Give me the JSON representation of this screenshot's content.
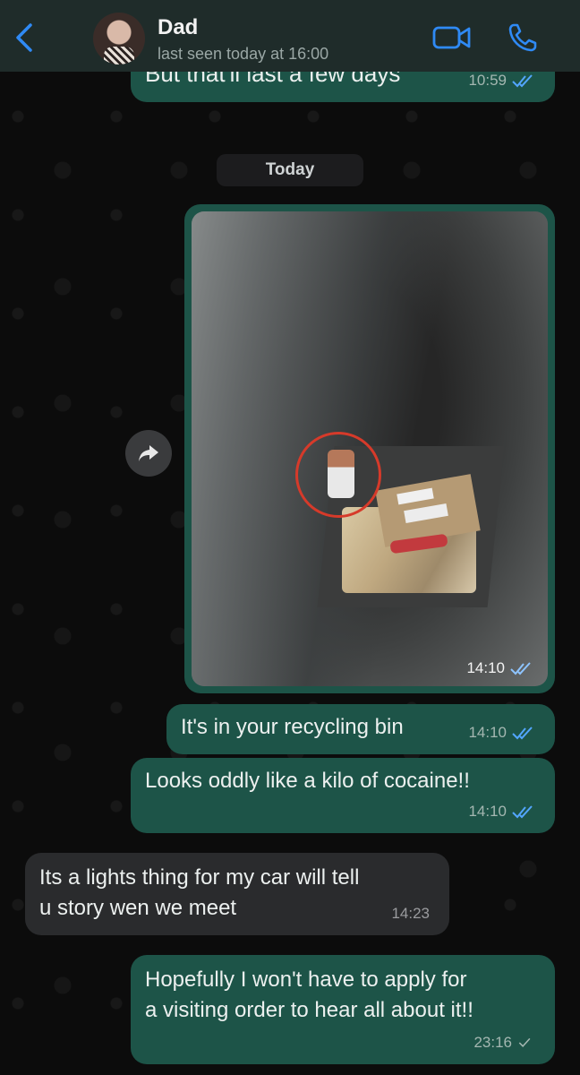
{
  "header": {
    "contact_name": "Dad",
    "last_seen": "last seen today at 16:00"
  },
  "date_divider": "Today",
  "messages": [
    {
      "id": "m0",
      "direction": "outgoing",
      "text": "But that'll last a few days",
      "time": "10:59",
      "status": "read"
    },
    {
      "id": "m1",
      "direction": "outgoing",
      "type": "photo",
      "time": "14:10",
      "status": "read"
    },
    {
      "id": "m2",
      "direction": "outgoing",
      "text": "It's in your recycling bin",
      "time": "14:10",
      "status": "read"
    },
    {
      "id": "m3",
      "direction": "outgoing",
      "text": "Looks oddly like a kilo of cocaine!!",
      "time": "14:10",
      "status": "read"
    },
    {
      "id": "m4",
      "direction": "incoming",
      "text_lines": [
        "Its a lights thing for my car will tell",
        "u story wen we meet"
      ],
      "time": "14:23"
    },
    {
      "id": "m5",
      "direction": "outgoing",
      "text_lines": [
        "Hopefully I won't have to apply for",
        "a visiting order to hear all about it!!"
      ],
      "time": "23:16",
      "status": "delivered"
    }
  ],
  "icons": {
    "back": "chevron-left-icon",
    "video": "video-camera-icon",
    "call": "phone-icon",
    "forward": "forward-icon",
    "read": "double-check-icon",
    "delivered": "single-check-icon"
  },
  "colors": {
    "accent": "#2f8af5",
    "outgoing_bubble": "#1d5448",
    "incoming_bubble": "#2a2b2d",
    "read_tick": "#53a6ff",
    "header_bg": "#1f2c2a"
  }
}
